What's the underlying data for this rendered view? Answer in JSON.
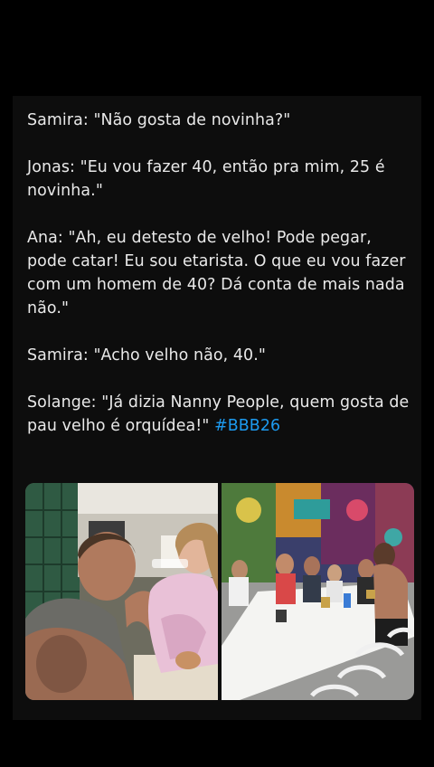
{
  "post": {
    "lines": [
      "Samira: \"Não gosta de novinha?\"",
      "Jonas: \"Eu vou fazer 40, então pra mim, 25 é novinha.\"",
      "Ana: \"Ah, eu detesto de velho! Pode pegar, pode catar! Eu sou etarista. O que eu vou fazer com um homem de 40? Dá conta de mais nada não.\"",
      "Samira: \"Acho velho não, 40.\""
    ],
    "last_line": "Solange: \"Já dizia Nanny People, quem gosta de pau velho é orquídea!\"",
    "hashtag": "#BBB26"
  },
  "media": {
    "left_description": "kitchen-scene-photo",
    "right_description": "dining-table-scene-photo"
  },
  "colors": {
    "background": "#000000",
    "card": "#0d0d0d",
    "text": "#e9e9e9",
    "hashtag": "#1d9bf0"
  }
}
